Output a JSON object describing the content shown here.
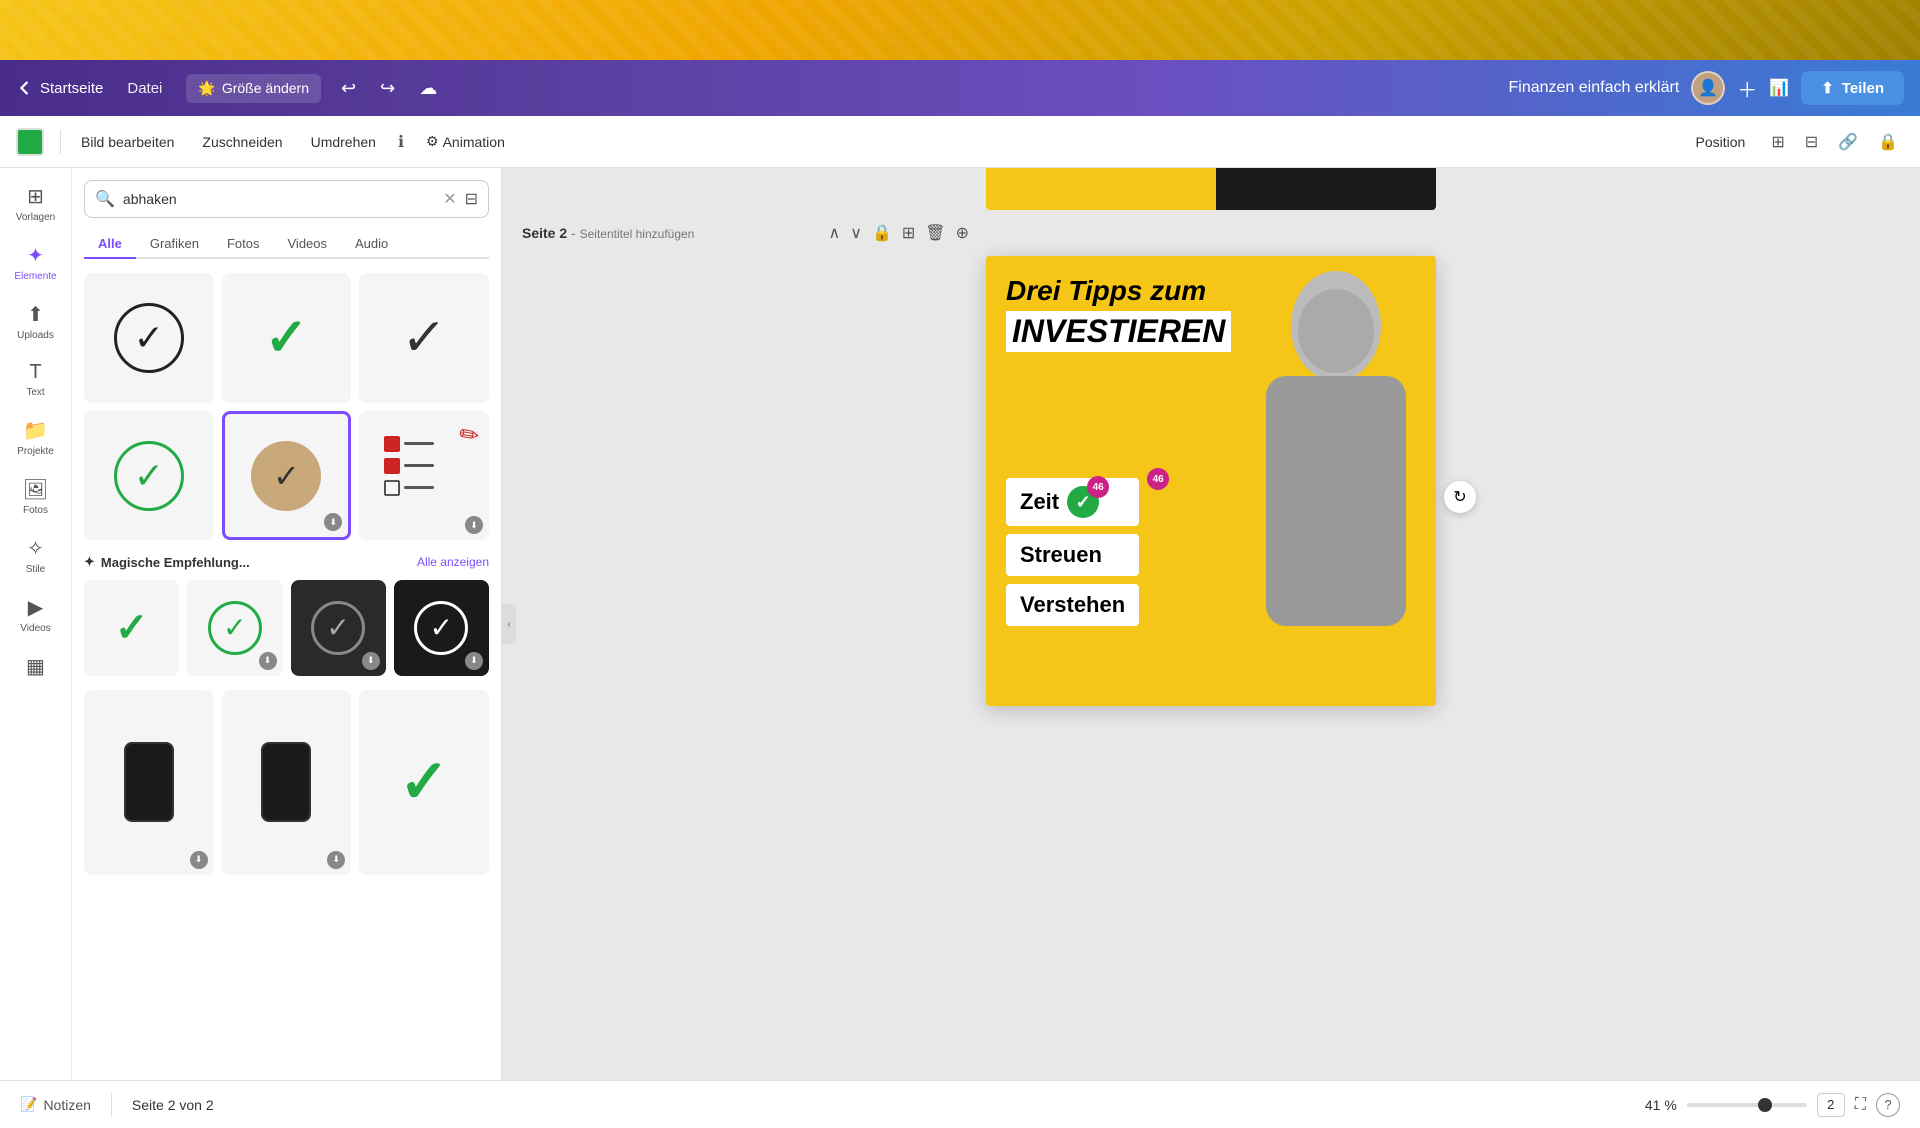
{
  "top_bar": {
    "label": "decorative"
  },
  "header": {
    "back_label": "Startseite",
    "file_label": "Datei",
    "size_label": "Größe ändern",
    "title": "Finanzen einfach erklärt",
    "share_label": "Teilen"
  },
  "toolbar2": {
    "bild_bearbeiten": "Bild bearbeiten",
    "zuschneiden": "Zuschneiden",
    "umdrehen": "Umdrehen",
    "animation": "Animation",
    "position": "Position"
  },
  "sidebar": {
    "icons": [
      {
        "id": "vorlagen",
        "label": "Vorlagen"
      },
      {
        "id": "elemente",
        "label": "Elemente"
      },
      {
        "id": "uploads",
        "label": "Uploads"
      },
      {
        "id": "text",
        "label": "Text"
      },
      {
        "id": "projekte",
        "label": "Projekte"
      },
      {
        "id": "fotos",
        "label": "Fotos"
      },
      {
        "id": "stile",
        "label": "Stile"
      },
      {
        "id": "videos",
        "label": "Videos"
      }
    ],
    "search": {
      "placeholder": "abhaken",
      "value": "abhaken"
    },
    "filter_tabs": [
      "Alle",
      "Grafiken",
      "Fotos",
      "Videos",
      "Audio"
    ],
    "active_tab": "Alle",
    "magic_section": {
      "title": "Magische Empfehlung...",
      "all_label": "Alle anzeigen"
    }
  },
  "canvas": {
    "page_label": "Seite 2",
    "page_subtitle": "Seitentitel hinzufügen",
    "page_info": "Seite 2 von 2",
    "slide": {
      "title1": "Drei Tipps zum",
      "title2": "INVESTIEREN",
      "items": [
        "Zeit",
        "Streuen",
        "Verstehen"
      ]
    }
  },
  "status_bar": {
    "notes_label": "Notizen",
    "page_info": "Seite 2 von 2",
    "zoom": "41 %",
    "page_num": "2"
  },
  "badges": {
    "num1": "46",
    "num2": "46"
  }
}
